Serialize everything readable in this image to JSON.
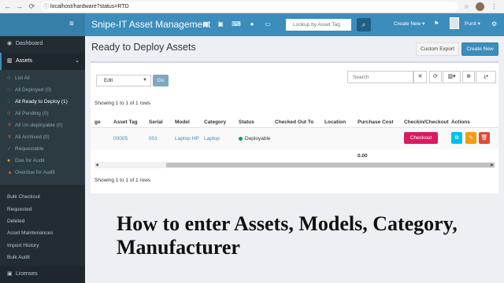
{
  "browser": {
    "url": "localhost/hardware?status=RTD"
  },
  "header": {
    "brand": "Snipe-IT Asset Management",
    "lookup_placeholder": "Lookup by Asset Tag",
    "create_new": "Create New ▾",
    "user_name": "Punit ▾"
  },
  "sidebar": {
    "dashboard": "Dashboard",
    "assets": "Assets",
    "sub_items": [
      {
        "label": "List All",
        "color": "#8aa4af"
      },
      {
        "label": "All Deployed (0)",
        "color": "#3c8dbc"
      },
      {
        "label": "All Ready to Deploy (1)",
        "color": "#00a65a"
      },
      {
        "label": "All Pending (0)",
        "color": "#f39c12"
      },
      {
        "label": "All Un-deployable (0)",
        "color": "#dd4b39"
      },
      {
        "label": "All Archived (0)",
        "color": "#dd4b39"
      },
      {
        "label": "Requestable",
        "color": "#3c8dbc"
      },
      {
        "label": "Due for Audit",
        "color": "#f39c12"
      },
      {
        "label": "Overdue for Audit",
        "color": "#dd4b39"
      }
    ],
    "links": [
      "Bulk Checkout",
      "Requested",
      "Deleted",
      "Asset Maintenances",
      "Import History",
      "Bulk Audit"
    ],
    "licenses": "Licenses"
  },
  "page": {
    "title": "Ready to Deploy Assets",
    "custom_export": "Custom Export",
    "create_new": "Create New",
    "bulk_action": "Edit",
    "go": "Go",
    "search_placeholder": "Search",
    "showing_top": "Showing 1 to 1 of 1 rows",
    "showing_bottom": "Showing 1 to 1 of 1 rows"
  },
  "table": {
    "columns": [
      "ge",
      "Asset Tag",
      "Serial",
      "Model",
      "Category",
      "Status",
      "Checked Out To",
      "Location",
      "Purchase Cost",
      "Checkin/Checkout",
      "Actions"
    ],
    "row": {
      "asset_tag": "00005",
      "serial": "001",
      "model": "Laptop HP",
      "category": "Laptop",
      "status": "Deployable",
      "checkout_label": "Checkout"
    },
    "total_cost": "0.00"
  },
  "caption": "How to enter Assets, Models, Category, Manufacturer",
  "colors": {
    "header": "#3c8dbc",
    "sidebar": "#222d32",
    "checkout": "#d81b60",
    "deployable": "#00a65a"
  }
}
